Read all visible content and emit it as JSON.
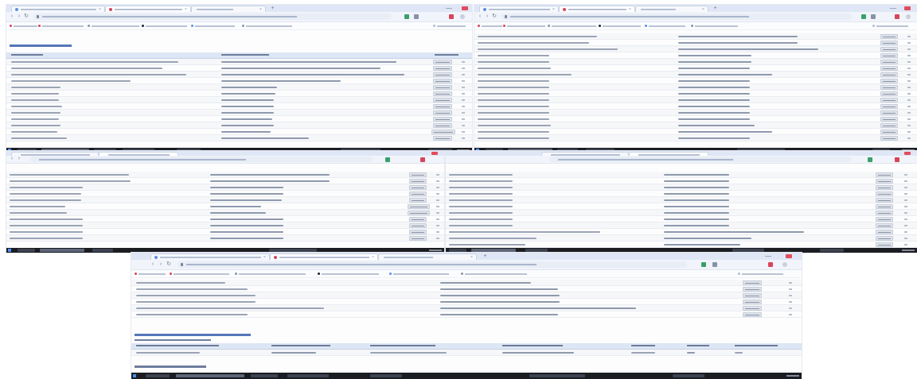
{
  "screens": [
    {
      "id": "top-left",
      "tabs": 3,
      "rows": 14,
      "has_title": true
    },
    {
      "id": "top-right",
      "tabs": 3,
      "rows": 14,
      "has_title": false
    },
    {
      "id": "middle-left",
      "tabs": 3,
      "rows": 12,
      "has_title": false
    },
    {
      "id": "middle-right",
      "tabs": 3,
      "rows": 12,
      "has_title": false
    },
    {
      "id": "bottom",
      "tabs": 3,
      "rows": 6,
      "has_title": false
    }
  ],
  "colors": {
    "tab_bar": "#dfe7f6",
    "accent_blue": "#5b8fe6",
    "accent_red": "#d6455a",
    "close_red": "#e24c5c",
    "taskbar": "#1b1d22",
    "table_header": "#dde6f4"
  },
  "icons": {
    "back": "arrow-left-icon",
    "forward": "arrow-right-icon",
    "reload": "reload-icon",
    "lock": "lock-icon",
    "new_tab": "plus-icon",
    "close_tab": "close-icon",
    "minimize": "minimize-icon",
    "maximize": "maximize-icon",
    "close_window": "close-icon",
    "start": "windows-start-icon"
  },
  "glyphs": {
    "back": "‹",
    "forward": "›",
    "reload": "↻",
    "close": "×",
    "new_tab": "+"
  }
}
